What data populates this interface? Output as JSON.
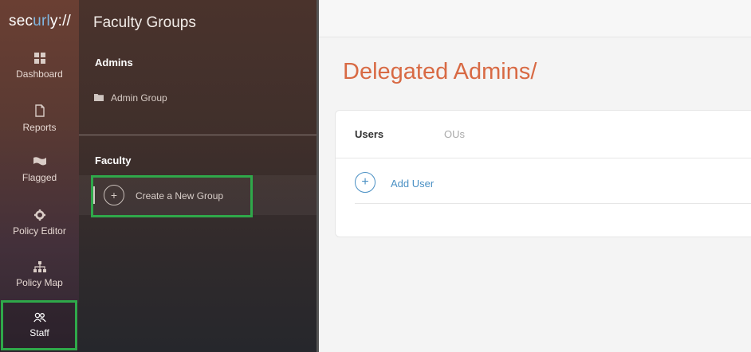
{
  "nav": {
    "logo": "securly://",
    "items": [
      {
        "label": "Dashboard",
        "icon": "dashboard-icon"
      },
      {
        "label": "Reports",
        "icon": "reports-icon"
      },
      {
        "label": "Flagged",
        "icon": "flag-icon"
      },
      {
        "label": "Policy Editor",
        "icon": "gear-icon"
      },
      {
        "label": "Policy Map",
        "icon": "sitemap-icon"
      },
      {
        "label": "Staff",
        "icon": "staff-icon"
      }
    ],
    "active": "Staff"
  },
  "groups": {
    "title": "Faculty Groups",
    "admins_label": "Admins",
    "admin_group": "Admin Group",
    "faculty_label": "Faculty",
    "create_label": "Create a New Group"
  },
  "main": {
    "title": "Delegated Admins/",
    "tabs": [
      "Users",
      "OUs"
    ],
    "active_tab": "Users",
    "add_user": "Add User"
  },
  "colors": {
    "title_accent": "#d86a44",
    "link_blue": "#4a90c4",
    "highlight_green": "#2fa84a"
  }
}
